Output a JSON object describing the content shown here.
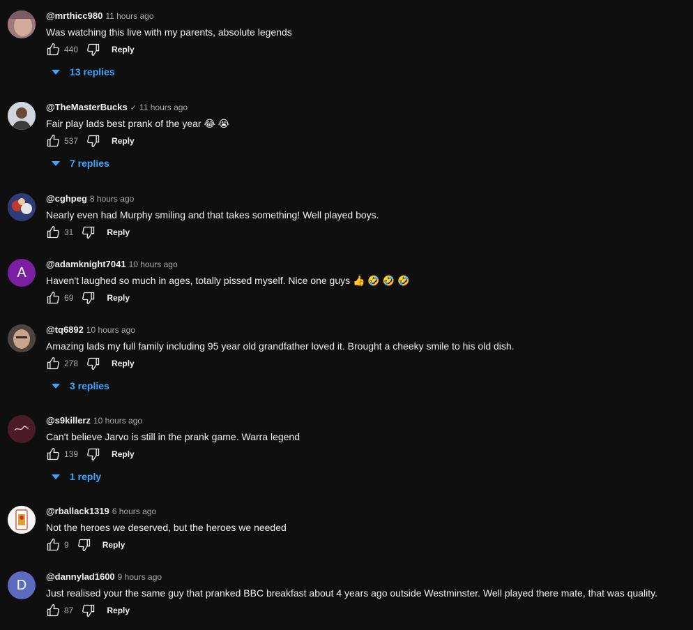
{
  "reply_label": "Reply",
  "comments": [
    {
      "author": "@mrthicc980",
      "time": "11 hours ago",
      "text": "Was watching this live with my parents, absolute legends",
      "likes": "440",
      "replies": "13 replies",
      "avatar_color": "#b48a8f",
      "avatar_letter": "",
      "verified": false
    },
    {
      "author": "@TheMasterBucks",
      "time": "11 hours ago",
      "text": "Fair play lads best prank of the year 😂 😭",
      "likes": "537",
      "replies": "7 replies",
      "avatar_color": "#d8dde3",
      "avatar_letter": "",
      "verified": true
    },
    {
      "author": "@cghpeg",
      "time": "8 hours ago",
      "text": "Nearly even had Murphy smiling and that takes something! Well played boys.",
      "likes": "31",
      "replies": "",
      "avatar_color": "#3a4a8a",
      "avatar_letter": "",
      "verified": false
    },
    {
      "author": "@adamknight7041",
      "time": "10 hours ago",
      "text": "Haven't laughed so much in ages, totally pissed myself. Nice one guys 👍 🤣 🤣 🤣",
      "likes": "69",
      "replies": "",
      "avatar_color": "#7b1fa2",
      "avatar_letter": "A",
      "verified": false
    },
    {
      "author": "@tq6892",
      "time": "10 hours ago",
      "text": "Amazing lads my full family including 95 year old grandfather loved it. Brought a cheeky smile to his old dish.",
      "likes": "278",
      "replies": "3 replies",
      "avatar_color": "#6b5d55",
      "avatar_letter": "",
      "verified": false
    },
    {
      "author": "@s9killerz",
      "time": "10 hours ago",
      "text": "Can't believe Jarvo is still in the prank game. Warra legend",
      "likes": "139",
      "replies": "1 reply",
      "avatar_color": "#5a2333",
      "avatar_letter": "",
      "verified": false
    },
    {
      "author": "@rballack1319",
      "time": "6 hours ago",
      "text": "Not the heroes we deserved, but the heroes we needed",
      "likes": "9",
      "replies": "",
      "avatar_color": "#f5f5f5",
      "avatar_letter": "",
      "verified": false
    },
    {
      "author": "@dannylad1600",
      "time": "9 hours ago",
      "text": "Just realised your the same guy that pranked BBC breakfast about 4 years ago outside Westminster. Well played there mate, that was quality.",
      "likes": "87",
      "replies": "",
      "avatar_color": "#5c6bc0",
      "avatar_letter": "D",
      "verified": false
    }
  ]
}
